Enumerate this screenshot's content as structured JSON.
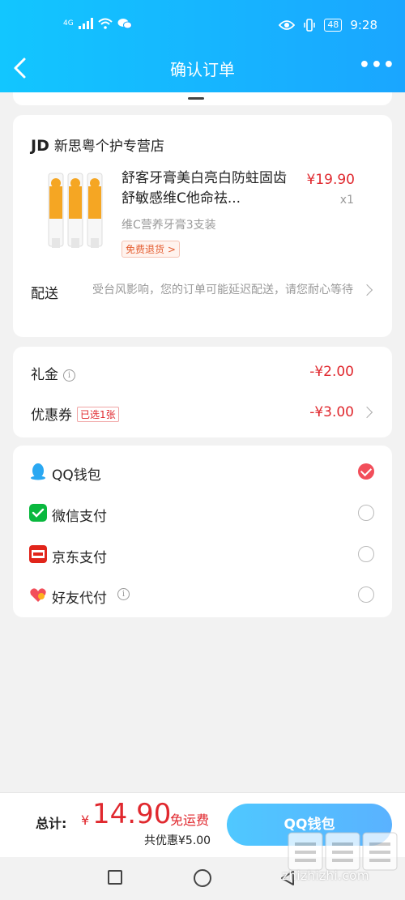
{
  "status": {
    "signal": "4G",
    "battery": "48",
    "time": "9:28"
  },
  "nav": {
    "title": "确认订单",
    "more": "•••"
  },
  "store": {
    "brand": "JD",
    "name": "新思粤个护专营店"
  },
  "product": {
    "title": "舒客牙膏美白亮白防蛀固齿舒敏感维C他命祛...",
    "price": "¥19.90",
    "qty": "x1",
    "spec": "维C营养牙膏3支装",
    "badge": "免费退货 >"
  },
  "shipping": {
    "label": "配送",
    "text": "受台风影响，您的订单可能延迟配送，请您耐心等待"
  },
  "discounts": {
    "gift_label": "礼金",
    "gift_amount": "-¥2.00",
    "coupon_label": "优惠券",
    "coupon_tag": "已选1张",
    "coupon_amount": "-¥3.00"
  },
  "payments": [
    {
      "label": "QQ钱包",
      "checked": true
    },
    {
      "label": "微信支付",
      "checked": false
    },
    {
      "label": "京东支付",
      "checked": false
    },
    {
      "label": "好友代付",
      "checked": false
    }
  ],
  "footer": {
    "total_label": "总计:",
    "currency": "¥",
    "total": "14.90",
    "free_ship": "免运费",
    "saved": "共优惠¥5.00",
    "pay_button": "QQ钱包"
  },
  "watermark": "zhizhizhi.com",
  "colors": {
    "brand_blue": "#1aa6ff",
    "price_red": "#e0282e",
    "check_red": "#f24e5a"
  }
}
